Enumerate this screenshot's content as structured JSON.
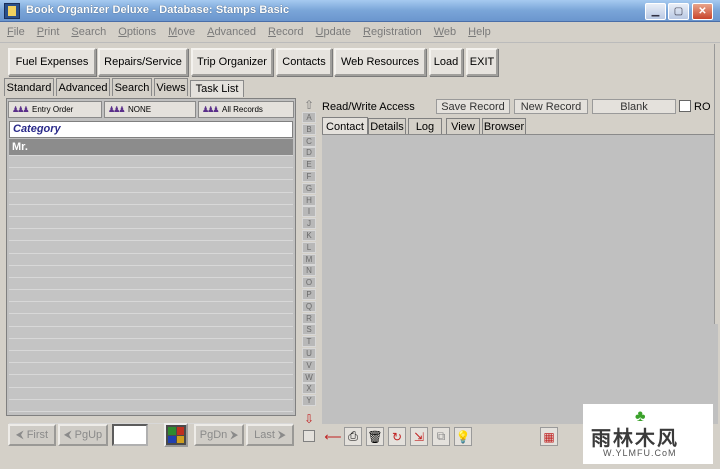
{
  "window": {
    "title": "Book Organizer Deluxe - Database: Stamps Basic",
    "minimize_label": "▁",
    "maximize_label": "▢",
    "close_label": "✕"
  },
  "menu": [
    "File",
    "Print",
    "Search",
    "Options",
    "Move",
    "Advanced",
    "Record",
    "Update",
    "Registration",
    "Web",
    "Help"
  ],
  "toolbar": [
    "Fuel Expenses",
    "Repairs/Service",
    "Trip Organizer",
    "Contacts",
    "Web Resources",
    "Load",
    "EXIT"
  ],
  "left_tabs": [
    "Standard",
    "Advanced",
    "Search",
    "Views",
    "Task List"
  ],
  "left_active_tab": "Task List",
  "filters": [
    "Entry Order",
    "NONE",
    "All Records"
  ],
  "category_header": "Category",
  "list": {
    "selected_item": "Mr.",
    "empty_rows": 22
  },
  "nav": {
    "first": "First",
    "pgup": "PgUp",
    "pgdn": "PgDn",
    "last": "Last"
  },
  "alphabet": [
    "A",
    "B",
    "C",
    "D",
    "E",
    "F",
    "G",
    "H",
    "I",
    "J",
    "K",
    "L",
    "M",
    "N",
    "O",
    "P",
    "Q",
    "R",
    "S",
    "T",
    "U",
    "V",
    "W",
    "X",
    "Y"
  ],
  "right_header": {
    "access": "Read/Write Access",
    "save": "Save Record",
    "new": "New Record",
    "blank": "Blank",
    "ro": "RO"
  },
  "right_tabs": [
    "Contact",
    "Details",
    "Log",
    "View",
    "Browser"
  ],
  "right_active_tab": "Contact",
  "bottom_icons": [
    "back-arrow-icon",
    "print-icon",
    "trash-icon",
    "refresh-icon",
    "export-icon",
    "copy-icon",
    "lightbulb-icon",
    "report-icon"
  ],
  "watermark": {
    "main": "雨林木风",
    "sub": "W.YLMFU.CoM"
  }
}
